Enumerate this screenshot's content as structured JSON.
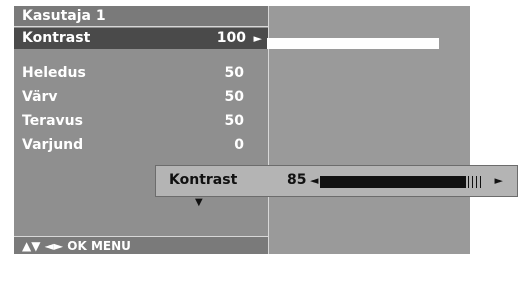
{
  "menu": {
    "title": "Kasutaja 1",
    "items": [
      {
        "label": "Kontrast",
        "value": "100"
      },
      {
        "label": "Heledus",
        "value": "50"
      },
      {
        "label": "Värv",
        "value": "50"
      },
      {
        "label": "Teravus",
        "value": "50"
      },
      {
        "label": "Varjund",
        "value": "0"
      }
    ],
    "footer": "▲▼  ◄►  OK  MENU"
  },
  "popup": {
    "label": "Kontrast",
    "value": "85",
    "level_fraction": 0.85
  },
  "icons": {
    "right_arrow": "►",
    "left_arrow": "◄",
    "down_arrow": "▼"
  },
  "colors": {
    "panel": "#8f8f8f",
    "selected": "#4a4a4a",
    "popup": "#b4b4b4",
    "bar": "#111111"
  }
}
